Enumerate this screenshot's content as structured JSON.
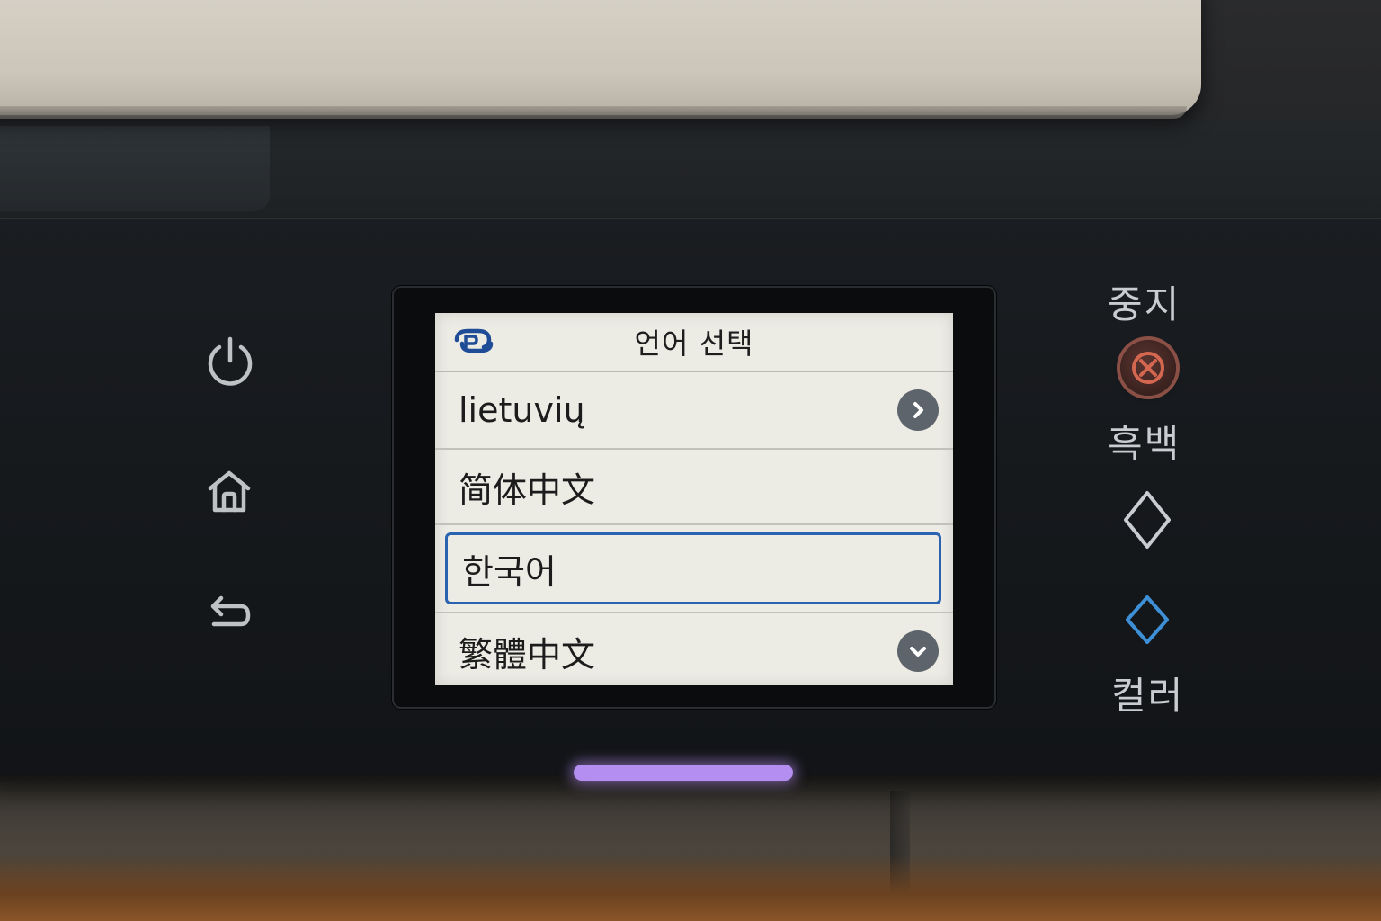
{
  "screen": {
    "title": "언어 선택",
    "brand_icon": "brand-logo-icon",
    "languages": [
      {
        "label": "lietuvių",
        "action_icon": "chevron-right-icon",
        "selected": false
      },
      {
        "label": "简体中文",
        "selected": false
      },
      {
        "label": "한국어",
        "selected": true
      },
      {
        "label": "繁體中文",
        "action_icon": "chevron-down-icon",
        "selected": false
      }
    ],
    "selection_color": "#2a63b0"
  },
  "left_keys": {
    "power_icon": "power-icon",
    "home_icon": "home-icon",
    "back_icon": "back-arrow-icon"
  },
  "right_keys": {
    "stop_label": "중지",
    "stop_icon": "close-icon",
    "stop_color": "#d4674f",
    "mono_label": "흑백",
    "mono_icon": "diamond-start-icon",
    "color_label": "컬러",
    "color_icon": "diamond-start-icon",
    "color_accent": "#3d8fd6"
  },
  "status_light_color": "#b48ef0"
}
